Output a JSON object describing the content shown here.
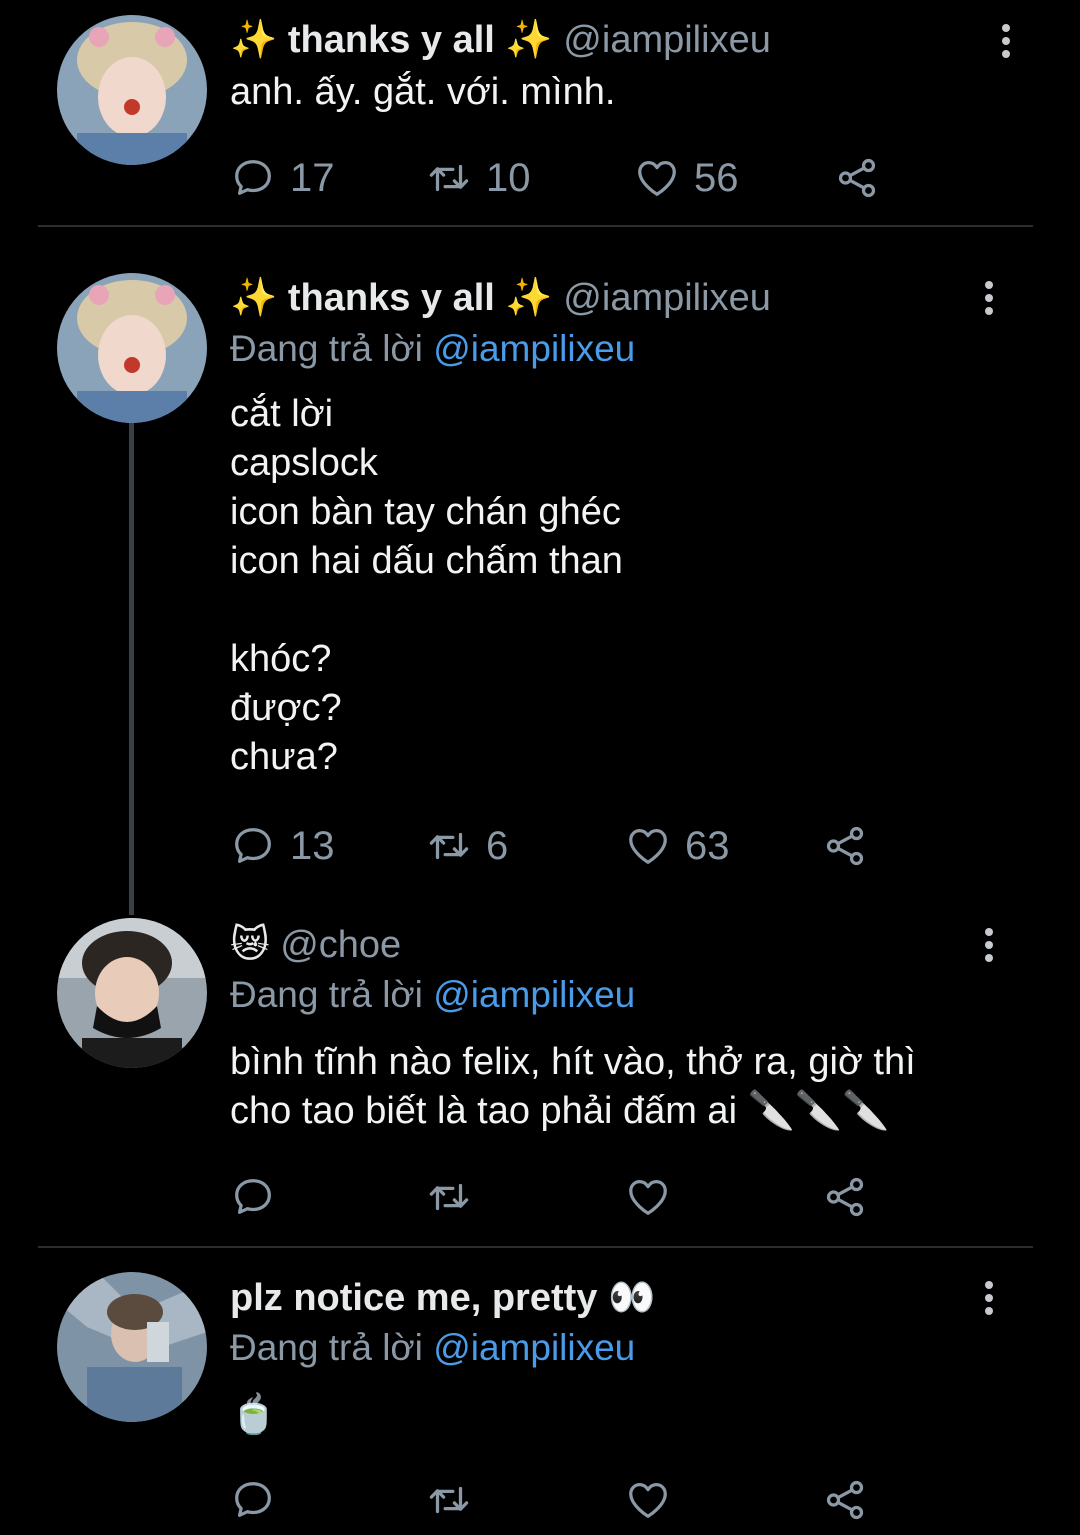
{
  "tweets": [
    {
      "display_name": "✨ thanks y all ✨",
      "handle": "@iampilixeu",
      "reply_prefix": "",
      "reply_mention": "",
      "text": "anh. ấy. gắt. với. mình.",
      "replies": "17",
      "retweets": "10",
      "likes": "56"
    },
    {
      "display_name": "✨ thanks y all ✨",
      "handle": "@iampilixeu",
      "reply_prefix": "Đang trả lời ",
      "reply_mention": "@iampilixeu",
      "text": "cắt lời\ncapslock\nicon bàn tay chán ghéc\nicon hai dấu chấm than\n\nkhóc?\nđược?\nchưa?",
      "replies": "13",
      "retweets": "6",
      "likes": "63"
    },
    {
      "display_name": "😿",
      "handle": "@choe",
      "reply_prefix": "Đang trả lời ",
      "reply_mention": "@iampilixeu",
      "text": "bình tĩnh nào felix, hít vào, thở ra, giờ thì\ncho tao biết là tao phải đấm ai 🔪🔪🔪",
      "replies": "",
      "retweets": "",
      "likes": ""
    },
    {
      "display_name": "plz notice me, pretty 👀",
      "handle": "",
      "reply_prefix": "Đang trả lời ",
      "reply_mention": "@iampilixeu",
      "text": "🍵",
      "replies": "",
      "retweets": "",
      "likes": ""
    }
  ],
  "colors": {
    "background": "#000000",
    "text": "#e7e9ea",
    "muted": "#8b98a5",
    "mention": "#4a9be8",
    "divider": "#2a2d31"
  },
  "icons": {
    "reply": "reply-icon",
    "retweet": "retweet-icon",
    "like": "heart-icon",
    "share": "share-icon",
    "more": "more-vertical-icon"
  }
}
